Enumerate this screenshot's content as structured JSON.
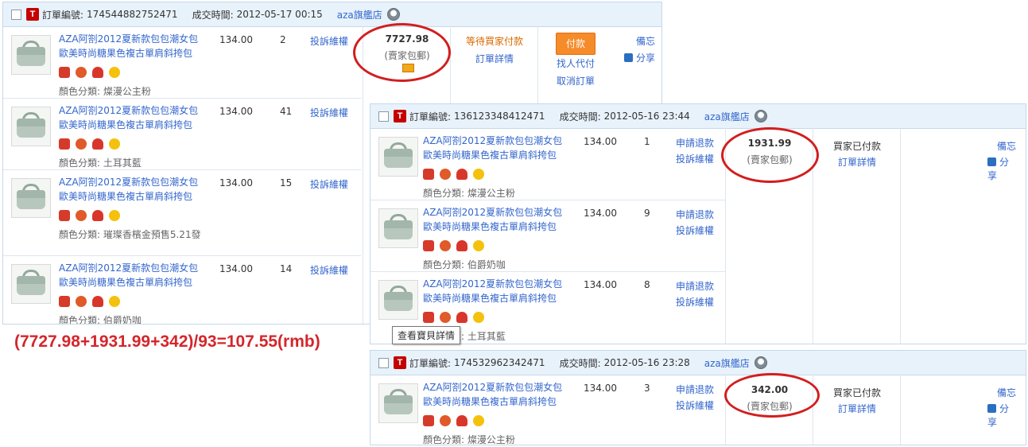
{
  "order1": {
    "label": "訂單編號:",
    "number": "174544882752471",
    "time_label": "成交時間:",
    "time": "2012-05-17 00:15",
    "shop": "aza旗艦店",
    "items": [
      {
        "name": "AZA阿劄2012夏新款包包潮女包歐美時尚糖果色複古單肩斜挎包",
        "color": "顏色分類: 燦漫公主粉",
        "price": "134.00",
        "qty": "2",
        "action": "投訴維權"
      },
      {
        "name": "AZA阿劄2012夏新款包包潮女包歐美時尚糖果色複古單肩斜挎包",
        "color": "顏色分類: 土耳其藍",
        "price": "134.00",
        "qty": "41",
        "action": "投訴維權"
      },
      {
        "name": "AZA阿劄2012夏新款包包潮女包歐美時尚糖果色複古單肩斜挎包",
        "color": "顏色分類: 璀璨香檳金預售5.21發",
        "price": "134.00",
        "qty": "15",
        "action": "投訴維權"
      },
      {
        "name": "AZA阿劄2012夏新款包包潮女包歐美時尚糖果色複古單肩斜挎包",
        "color": "顏色分類: 伯爵奶咖",
        "price": "134.00",
        "qty": "14",
        "action": "投訴維權"
      }
    ],
    "total": "7727.98",
    "shipping": "(賣家包郵)",
    "status": "等待買家付款",
    "detail": "訂單詳情",
    "pay": "付款",
    "proxy": "找人代付",
    "cancel": "取消訂單",
    "note": "備忘",
    "share": "分享"
  },
  "order2": {
    "label": "訂單編號:",
    "number": "136123348412471",
    "time_label": "成交時間:",
    "time": "2012-05-16 23:44",
    "shop": "aza旗艦店",
    "items": [
      {
        "name": "AZA阿劄2012夏新款包包潮女包歐美時尚糖果色複古單肩斜挎包",
        "color": "顏色分類: 燦漫公主粉",
        "price": "134.00",
        "qty": "1",
        "action1": "申請退款",
        "action2": "投訴維權"
      },
      {
        "name": "AZA阿劄2012夏新款包包潮女包歐美時尚糖果色複古單肩斜挎包",
        "color": "顏色分類: 伯爵奶咖",
        "price": "134.00",
        "qty": "9",
        "action1": "申請退款",
        "action2": "投訴維權"
      },
      {
        "name": "AZA阿劄2012夏新款包包潮女包歐美時尚糖果色複古單肩斜挎包",
        "color": "顏色分類: 土耳其藍",
        "price": "134.00",
        "qty": "8",
        "action1": "申請退款",
        "action2": "投訴維權"
      }
    ],
    "total": "1931.99",
    "shipping": "(賣家包郵)",
    "status": "買家已付款",
    "detail": "訂單詳情",
    "note": "備忘",
    "share": "分享"
  },
  "order3": {
    "label": "訂單編號:",
    "number": "174532962342471",
    "time_label": "成交時間:",
    "time": "2012-05-16 23:28",
    "shop": "aza旗艦店",
    "items": [
      {
        "name": "AZA阿劄2012夏新款包包潮女包歐美時尚糖果色複古單肩斜挎包",
        "color": "顏色分類: 燦漫公主粉",
        "price": "134.00",
        "qty": "3",
        "action1": "申請退款",
        "action2": "投訴維權"
      }
    ],
    "total": "342.00",
    "shipping": "(賣家包郵)",
    "status": "買家已付款",
    "detail": "訂單詳情",
    "note": "備忘",
    "share": "分享"
  },
  "formula": "(7727.98+1931.99+342)/93=107.55(rmb)",
  "tooltip": "查看寶貝詳情",
  "colors": {
    "link": "#3366cc",
    "header_bg": "#e8f2fb",
    "circle": "#d21e1e",
    "formula": "#d4262b",
    "pay_button": "#f68b2a"
  }
}
